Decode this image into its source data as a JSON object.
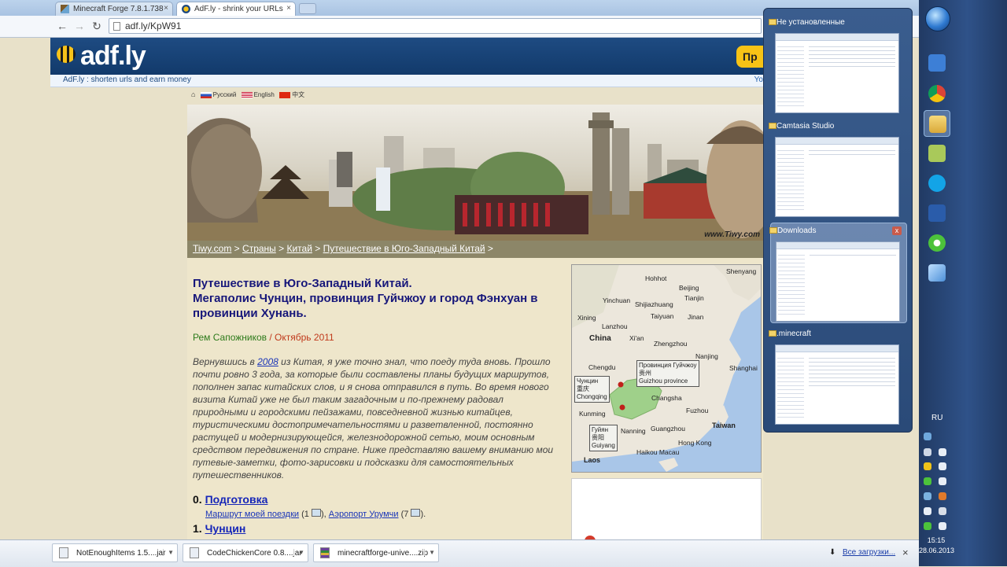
{
  "browser": {
    "tabs": [
      {
        "label": "Minecraft Forge 7.8.1.738",
        "close": "×",
        "active": false
      },
      {
        "label": "AdF.ly - shrink your URLs",
        "close": "×",
        "active": true
      }
    ],
    "url": "adf.ly/KpW91",
    "nav": {
      "back": "←",
      "forward": "→",
      "reload": "↻"
    }
  },
  "adfly": {
    "logo": "adf.ly",
    "tagline_brand": "AdF.ly",
    "tagline": " : shorten urls and earn money",
    "button": "Пр",
    "right_text": "Yo"
  },
  "page": {
    "lang_links": [
      "Русский",
      "English",
      "中文"
    ],
    "banner_credit": "www.Tiwy.com",
    "breadcrumb": [
      "Tiwy.com",
      "Страны",
      "Китай",
      "Путешествие в Юго-Западный Китай"
    ],
    "breadcrumb_sep": " > ",
    "title_lines": [
      "Путешествие в Юго-Западный Китай.",
      "Мегаполис Чунцин, провинция Гуйчжоу и город Фэнхуан в провинции Хунань."
    ],
    "author": "Рем Сапожников",
    "date": " / Октябрь 2011",
    "intro_part1": "Вернувшись в ",
    "intro_link": "2008",
    "intro_part2": " из Китая, я уже точно знал, что поеду туда вновь. Прошло почти ровно 3 года, за которые были составлены планы будущих маршрутов, пополнен запас китайских слов, и я снова отправился в путь. Во время нового визита Китай уже не был таким загадочным и по-прежнему радовал природными и городскими пейзажами, повседневной жизнью китайцев, туристическими достопримечательностями и разветвленной, постоянно растущей и модернизирующейся, железнодорожной сетью, моим основным средством передвижения по стране. Ниже представляю вашему вниманию мои путевые-заметки, фото-зарисовки и подсказки для самостоятельных путешественников.",
    "sections": [
      {
        "num": "0. ",
        "label": "Подготовка"
      },
      {
        "num": "1. ",
        "label": "Чунцин"
      }
    ],
    "sublinks": {
      "link1": "Маршрут моей поездки",
      "count1": " (1 ",
      "sep": "), ",
      "link2": "Аэропорт Урумчи",
      "count2": " (7 ",
      "end": ")."
    }
  },
  "map": {
    "labels": [
      "Shenyang",
      "Hohhot",
      "Beijing",
      "Tianjin",
      "Yinchuan",
      "Shijiazhuang",
      "Taiyuan",
      "Jinan",
      "Xining",
      "Lanzhou",
      "China",
      "Xi'an",
      "Zhengzhou",
      "Nanjing",
      "Shanghai",
      "Chengdu",
      "Changsha",
      "Fuzhou",
      "Kunming",
      "Nanning",
      "Guangzhou",
      "Taiwan",
      "Hong Kong",
      "Haikou Macau",
      "Laos"
    ],
    "box_guizhou": [
      "Провинция Гуйчжоу",
      "贵州",
      "Guizhou province"
    ],
    "box_chongqing": [
      "Чунцин",
      "重庆",
      "Chongqing"
    ],
    "box_guiyang": [
      "Гуйян",
      "贵阳",
      "Guiyang"
    ]
  },
  "downloads": {
    "items": [
      "NotEnoughItems 1.5....jar",
      "CodeChickenCore 0.8....jar",
      "minecraftforge-unive....zip"
    ],
    "all": "Все загрузки...",
    "close": "×"
  },
  "thumbnails": [
    {
      "title": "Не установленные",
      "highlighted": false
    },
    {
      "title": "Camtasia Studio",
      "highlighted": false
    },
    {
      "title": "Downloads",
      "highlighted": true
    },
    {
      "title": ".minecraft",
      "highlighted": false
    }
  ],
  "taskbar": {
    "lang": "RU",
    "time": "15:15",
    "date": "28.06.2013"
  },
  "colors": {
    "adfly_blue": "#1e4b82",
    "breadcrumb_bg": "#8c8668",
    "title_blue": "#17177a",
    "author_green": "#2c7a1a",
    "date_red": "#c0391b"
  }
}
